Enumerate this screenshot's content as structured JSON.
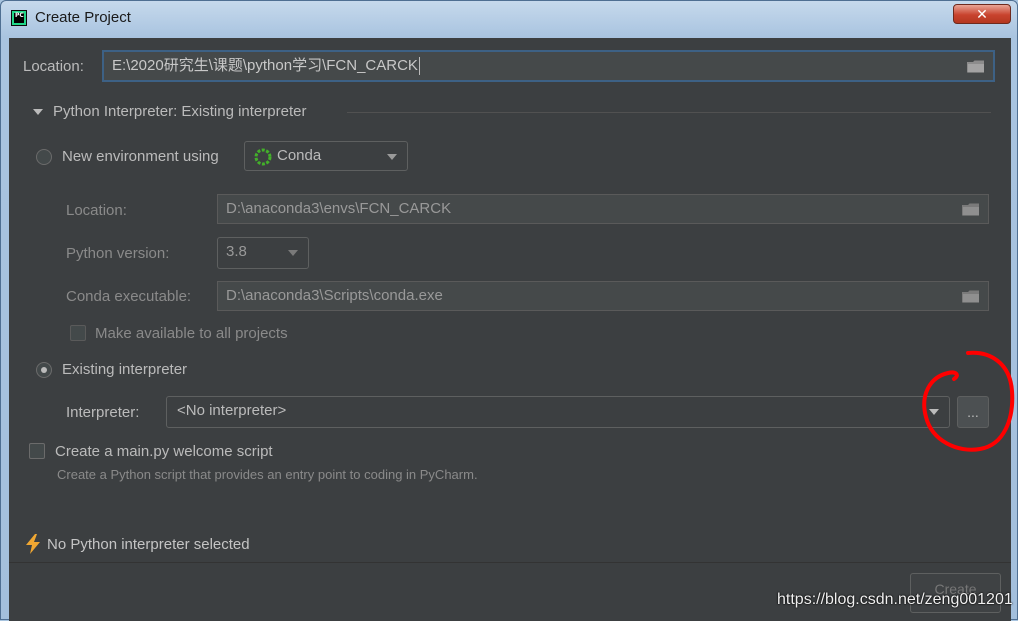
{
  "window": {
    "title": "Create Project",
    "close_label": "✕"
  },
  "location": {
    "label": "Location:",
    "value": "E:\\2020研究生\\课题\\python学习\\FCN_CARCK"
  },
  "interpreter_section": {
    "title": "Python Interpreter: Existing interpreter"
  },
  "new_env": {
    "label": "New environment using",
    "tool": "Conda",
    "location_label": "Location:",
    "location_value": "D:\\anaconda3\\envs\\FCN_CARCK",
    "python_version_label": "Python version:",
    "python_version_value": "3.8",
    "conda_exe_label": "Conda executable:",
    "conda_exe_value": "D:\\anaconda3\\Scripts\\conda.exe",
    "make_available_label": "Make available to all projects"
  },
  "existing": {
    "label": "Existing interpreter",
    "interpreter_label": "Interpreter:",
    "interpreter_value": "<No interpreter>",
    "browse_label": "..."
  },
  "welcome": {
    "label": "Create a main.py welcome script",
    "description": "Create a Python script that provides an entry point to coding in PyCharm."
  },
  "status": {
    "message": "No Python interpreter selected"
  },
  "footer": {
    "create_label": "Create"
  },
  "watermark": {
    "text": "https://blog.csdn.net/zeng001201"
  },
  "colors": {
    "background": "#3c3f41",
    "text": "#bbbbbb",
    "focus_border": "#3d6185",
    "warning": "#f0a732",
    "annotation": "#ff0000"
  }
}
